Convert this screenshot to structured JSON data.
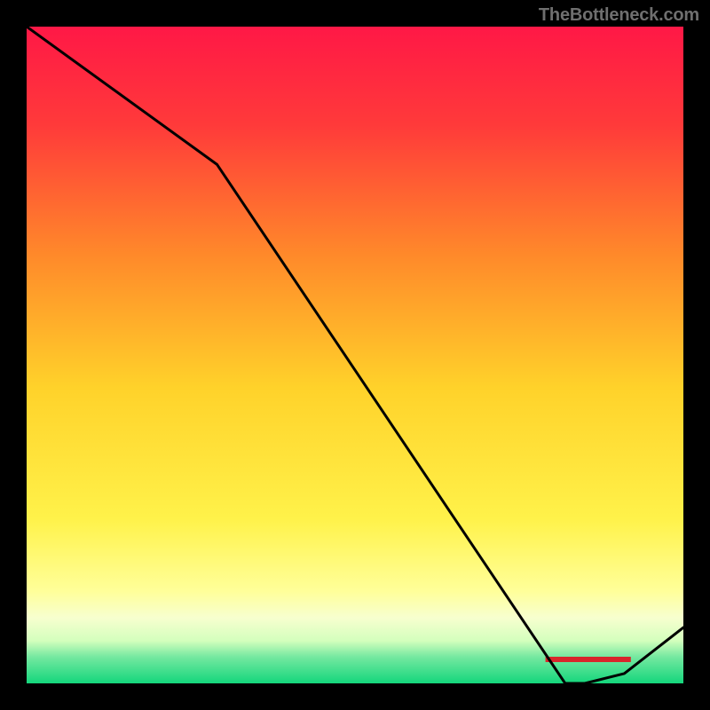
{
  "watermark": "TheBottleneck.com",
  "chart_data": {
    "type": "line",
    "x": [
      0.0,
      0.29,
      0.82,
      0.85,
      0.91,
      1.0
    ],
    "y": [
      1.0,
      0.79,
      0.0,
      0.0,
      0.015,
      0.085
    ],
    "xlabel": "",
    "ylabel": "",
    "xlim": [
      0,
      1
    ],
    "ylim": [
      0,
      1
    ],
    "title": "",
    "note": "normalized coordinates inferred from pixels; no axis ticks or labels visible",
    "gradient_stops": [
      {
        "pos": 0.0,
        "color": "#ff1846"
      },
      {
        "pos": 0.15,
        "color": "#ff3a3a"
      },
      {
        "pos": 0.35,
        "color": "#ff8a2a"
      },
      {
        "pos": 0.55,
        "color": "#ffd22a"
      },
      {
        "pos": 0.75,
        "color": "#fff24a"
      },
      {
        "pos": 0.86,
        "color": "#ffff9a"
      },
      {
        "pos": 0.9,
        "color": "#f7ffcf"
      },
      {
        "pos": 0.935,
        "color": "#d4ffbd"
      },
      {
        "pos": 0.96,
        "color": "#74e8a0"
      },
      {
        "pos": 1.0,
        "color": "#14d67c"
      }
    ],
    "bottom_marker": {
      "color": "#d8262b",
      "x_start": 0.79,
      "x_end": 0.92,
      "label": ""
    }
  }
}
